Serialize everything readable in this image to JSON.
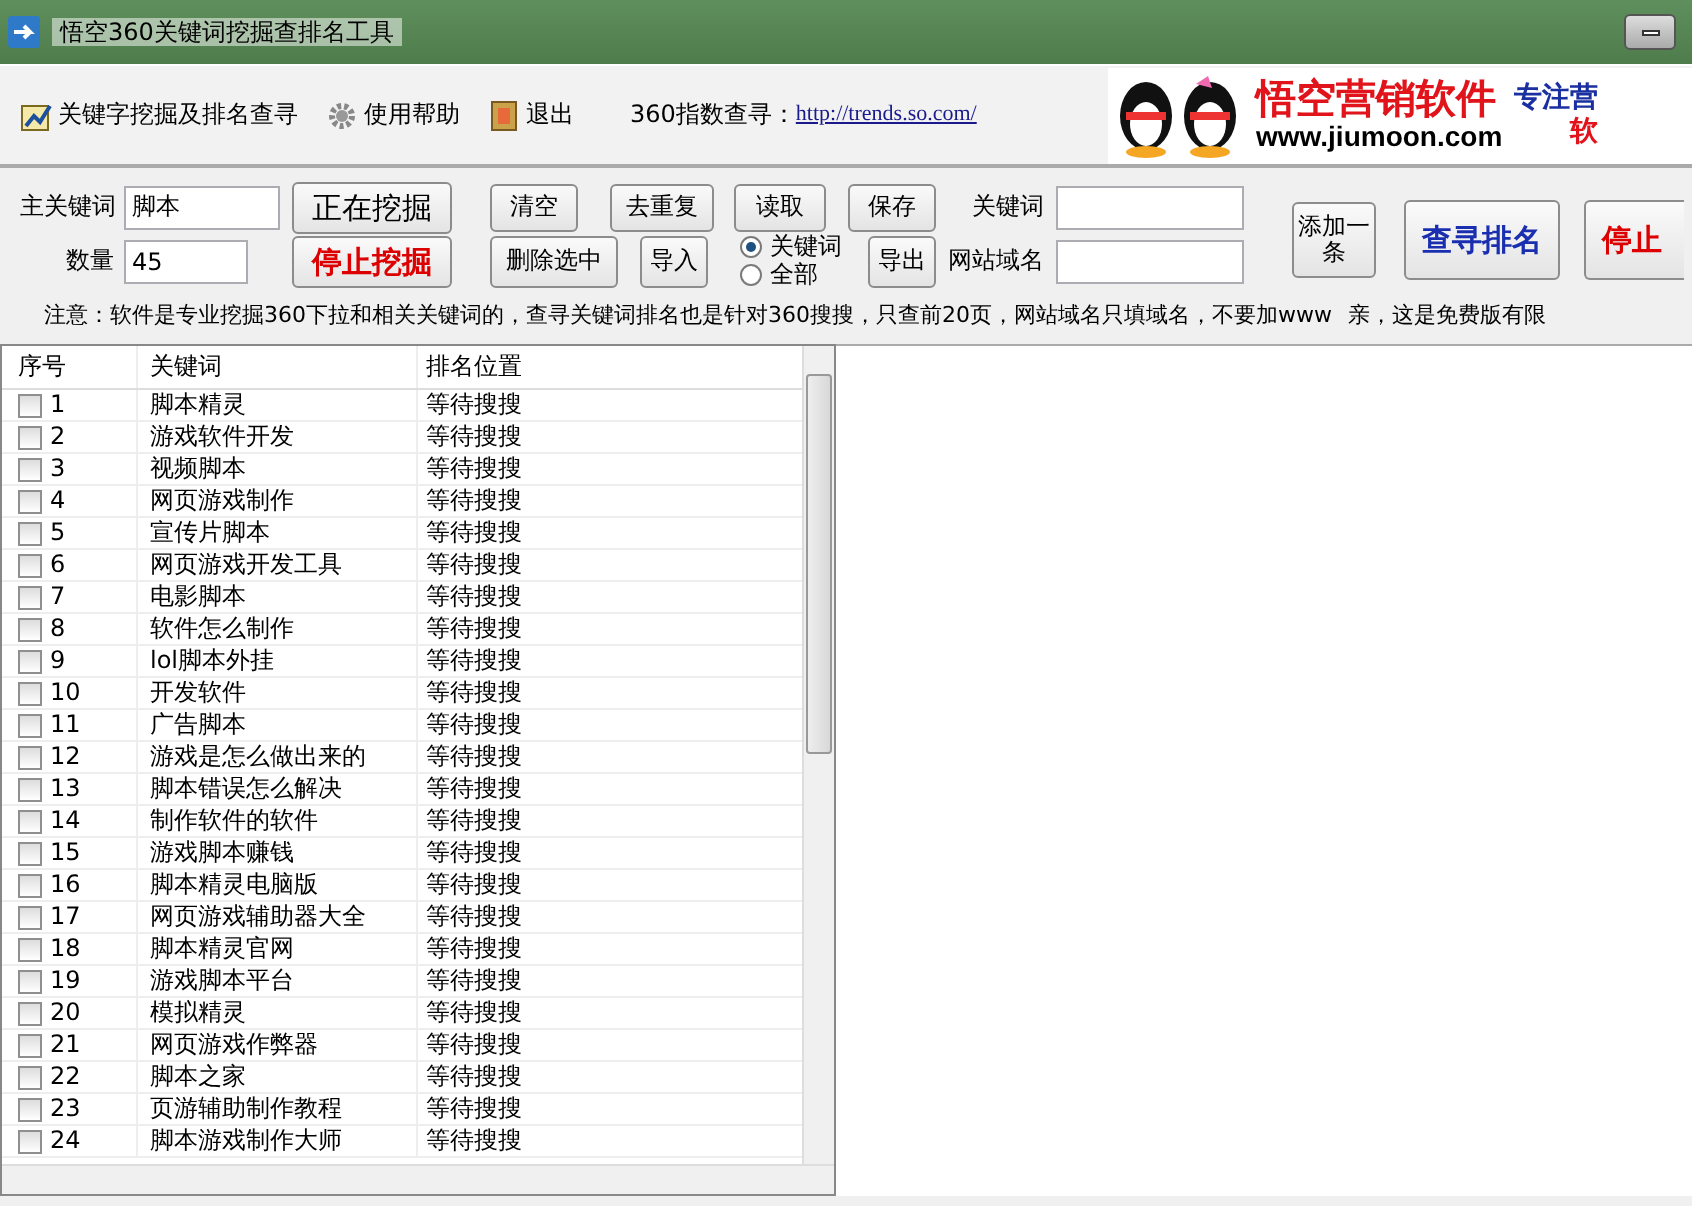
{
  "window": {
    "title": "悟空360关键词挖掘查排名工具"
  },
  "toolbar": [
    {
      "label": "关键字挖掘及排名查寻",
      "kind": "chart"
    },
    {
      "label": "使用帮助",
      "kind": "gear"
    },
    {
      "label": "退出",
      "kind": "exit"
    }
  ],
  "index_link": {
    "label": "360指数查寻：",
    "url": "http://trends.so.com/"
  },
  "banner": {
    "brand": "悟空营销软件",
    "site": "www.jiumoon.com",
    "slogan": "专注营",
    "slogan_2": "软"
  },
  "form": {
    "main_keyword": {
      "label": "主关键词",
      "value": "脚本"
    },
    "count": {
      "label": "数量",
      "value": "45"
    },
    "keyword": {
      "label": "关键词"
    },
    "domain": {
      "label": "网站域名"
    }
  },
  "buttons": {
    "mining": "正在挖掘",
    "stop_mining": "停止挖掘",
    "clear": "清空",
    "dedupe": "去重复",
    "read": "读取",
    "save": "保存",
    "delete_selected": "删除选中",
    "import": "导入",
    "export": "导出",
    "add": "添加一条",
    "query": "查寻排名",
    "stop_query": "停止"
  },
  "scope": [
    {
      "label": "关键词",
      "selected": true
    },
    {
      "label": "全部",
      "selected": false
    }
  ],
  "notice": [
    "注意：软件是专业挖掘360下拉和相关关键词的，查寻关键词排名也是针对360搜搜，只查前20页，网站域名只填域名，不要加www",
    "亲，这是免费版有限"
  ],
  "table": {
    "columns": [
      "序号",
      "关键词",
      "排名位置"
    ],
    "rows": [
      {
        "no": "1",
        "keyword": "脚本精灵",
        "rank": "等待搜搜",
        "checked": false
      },
      {
        "no": "2",
        "keyword": "游戏软件开发",
        "rank": "等待搜搜",
        "checked": false
      },
      {
        "no": "3",
        "keyword": "视频脚本",
        "rank": "等待搜搜",
        "checked": false
      },
      {
        "no": "4",
        "keyword": "网页游戏制作",
        "rank": "等待搜搜",
        "checked": false
      },
      {
        "no": "5",
        "keyword": "宣传片脚本",
        "rank": "等待搜搜",
        "checked": false
      },
      {
        "no": "6",
        "keyword": "网页游戏开发工具",
        "rank": "等待搜搜",
        "checked": false
      },
      {
        "no": "7",
        "keyword": "电影脚本",
        "rank": "等待搜搜",
        "checked": false
      },
      {
        "no": "8",
        "keyword": "软件怎么制作",
        "rank": "等待搜搜",
        "checked": false
      },
      {
        "no": "9",
        "keyword": "lol脚本外挂",
        "rank": "等待搜搜",
        "checked": false
      },
      {
        "no": "10",
        "keyword": "开发软件",
        "rank": "等待搜搜",
        "checked": false
      },
      {
        "no": "11",
        "keyword": "广告脚本",
        "rank": "等待搜搜",
        "checked": false
      },
      {
        "no": "12",
        "keyword": "游戏是怎么做出来的",
        "rank": "等待搜搜",
        "checked": false
      },
      {
        "no": "13",
        "keyword": "脚本错误怎么解决",
        "rank": "等待搜搜",
        "checked": false
      },
      {
        "no": "14",
        "keyword": "制作软件的软件",
        "rank": "等待搜搜",
        "checked": false
      },
      {
        "no": "15",
        "keyword": "游戏脚本赚钱",
        "rank": "等待搜搜",
        "checked": false
      },
      {
        "no": "16",
        "keyword": "脚本精灵电脑版",
        "rank": "等待搜搜",
        "checked": false
      },
      {
        "no": "17",
        "keyword": "网页游戏辅助器大全",
        "rank": "等待搜搜",
        "checked": false
      },
      {
        "no": "18",
        "keyword": "脚本精灵官网",
        "rank": "等待搜搜",
        "checked": false
      },
      {
        "no": "19",
        "keyword": "游戏脚本平台",
        "rank": "等待搜搜",
        "checked": false
      },
      {
        "no": "20",
        "keyword": "模拟精灵",
        "rank": "等待搜搜",
        "checked": false
      },
      {
        "no": "21",
        "keyword": "网页游戏作弊器",
        "rank": "等待搜搜",
        "checked": false
      },
      {
        "no": "22",
        "keyword": "脚本之家",
        "rank": "等待搜搜",
        "checked": false
      },
      {
        "no": "23",
        "keyword": "页游辅助制作教程",
        "rank": "等待搜搜",
        "checked": false
      },
      {
        "no": "24",
        "keyword": "脚本游戏制作大师",
        "rank": "等待搜搜",
        "checked": false
      }
    ]
  }
}
